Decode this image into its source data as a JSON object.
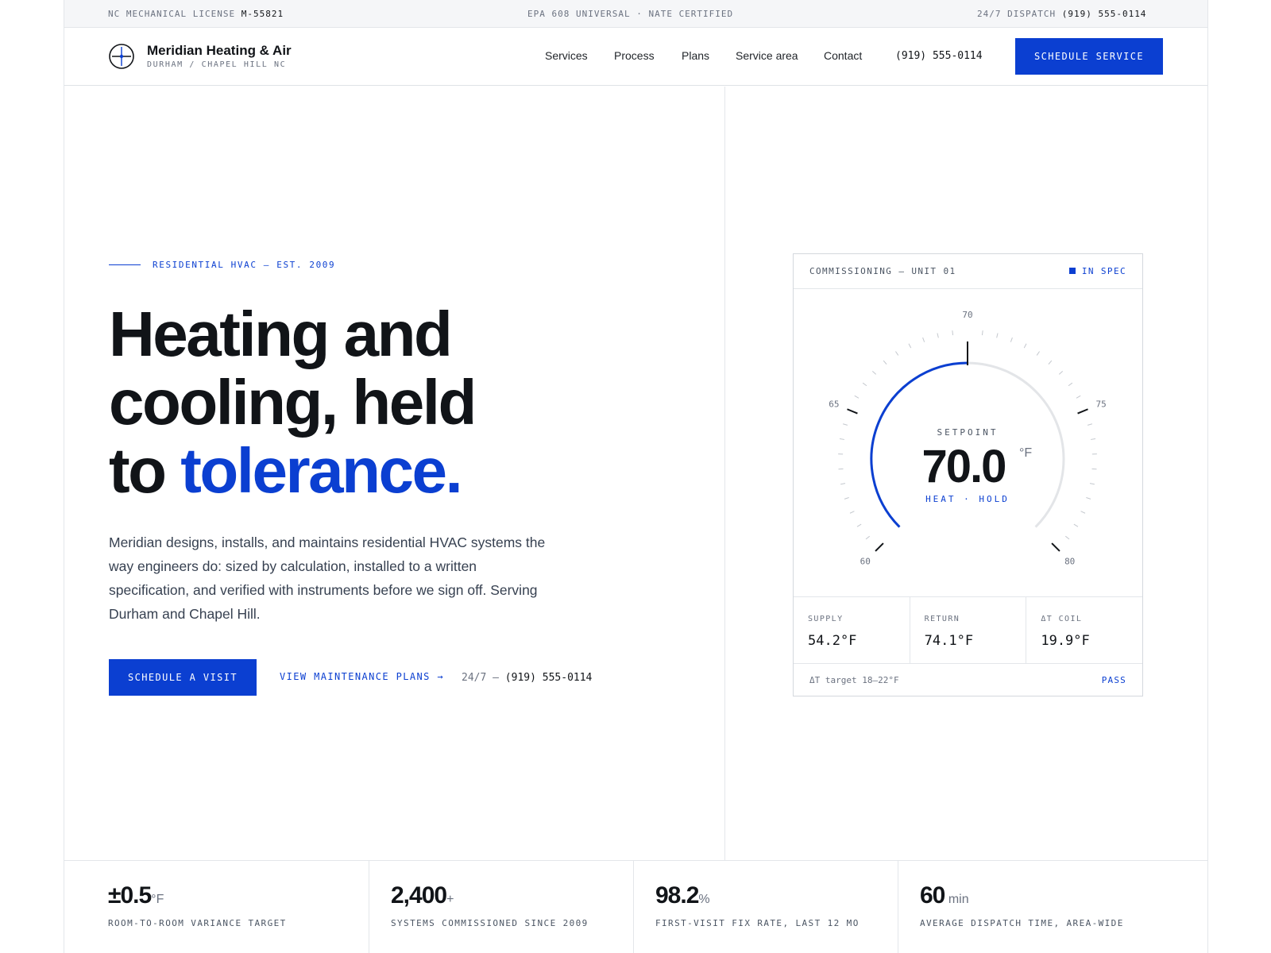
{
  "topbar": {
    "license_label": "NC MECHANICAL LICENSE",
    "license_number": "M-55821",
    "certifications": "EPA 608 UNIVERSAL · NATE CERTIFIED",
    "dispatch_label": "24/7 DISPATCH",
    "dispatch_phone": "(919) 555-0114"
  },
  "header": {
    "brand_name": "Meridian Heating & Air",
    "brand_sub": "DURHAM / CHAPEL HILL NC",
    "nav": [
      "Services",
      "Process",
      "Plans",
      "Service area",
      "Contact"
    ],
    "phone": "(919) 555-0114",
    "cta": "SCHEDULE SERVICE"
  },
  "hero": {
    "eyebrow": "RESIDENTIAL HVAC — EST. 2009",
    "headline_line1": "Heating and",
    "headline_line2": "cooling, held",
    "headline_line3_plain": "to",
    "headline_line3_accent": "tolerance.",
    "lead": "Meridian designs, installs, and maintains residential HVAC systems the way engineers do: sized by calculation, installed to a written specification, and verified with instruments before we sign off. Serving Durham and Chapel Hill.",
    "primary_cta": "SCHEDULE A VISIT",
    "secondary_cta": "VIEW MAINTENANCE PLANS →",
    "phone_prefix": "24/7 —",
    "phone": "(919) 555-0114"
  },
  "card": {
    "title": "COMMISSIONING — UNIT 01",
    "status": "IN SPEC",
    "gauge": {
      "min": 60,
      "max": 80,
      "value": 70.0,
      "tick_labels": [
        "60",
        "65",
        "70",
        "75",
        "80"
      ],
      "label": "SETPOINT",
      "value_text": "70.0",
      "unit": "°F",
      "mode": "HEAT · HOLD"
    },
    "readouts": [
      {
        "label": "SUPPLY",
        "value": "54.2°F"
      },
      {
        "label": "RETURN",
        "value": "74.1°F"
      },
      {
        "label": "ΔT COIL",
        "value": "19.9°F"
      }
    ],
    "footer_note": "ΔT target 18–22°F",
    "footer_result": "PASS"
  },
  "stats": [
    {
      "value": "±0.5",
      "unit": "°F",
      "label": "ROOM-TO-ROOM VARIANCE TARGET"
    },
    {
      "value": "2,400",
      "unit": "+",
      "label": "SYSTEMS COMMISSIONED SINCE 2009"
    },
    {
      "value": "98.2",
      "unit": "%",
      "label": "FIRST-VISIT FIX RATE, LAST 12 MO"
    },
    {
      "value": "60",
      "unit": " min",
      "label": "AVERAGE DISPATCH TIME, AREA-WIDE"
    }
  ],
  "colors": {
    "accent": "#0b3fd1",
    "ink": "#111418",
    "muted": "#6b7280",
    "rule": "#e3e6ea"
  }
}
